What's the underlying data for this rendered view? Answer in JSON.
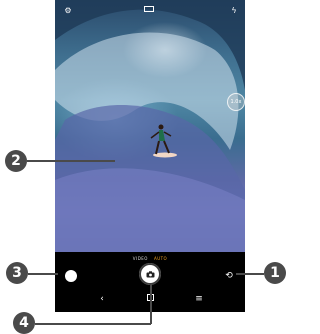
{
  "camera": {
    "top_bar": {
      "settings_icon": "gear-icon",
      "aspect_icon": "aspect-ratio-icon",
      "flash_icon": "flash-auto-icon"
    },
    "zoom_label": "1.0x",
    "modes": [
      "VIDEO",
      "AUTO"
    ],
    "active_mode": "AUTO",
    "controls": {
      "gallery_icon": "gallery-thumbnail",
      "shutter_icon": "camera-icon",
      "switch_icon": "switch-camera-icon"
    },
    "nav": [
      "back-icon",
      "home-icon",
      "menu-icon"
    ]
  },
  "callouts": {
    "one": "1",
    "two": "2",
    "three": "3",
    "four": "4"
  },
  "colors": {
    "callout_bg": "#4a4a4a",
    "active_mode": "#f5a623"
  }
}
